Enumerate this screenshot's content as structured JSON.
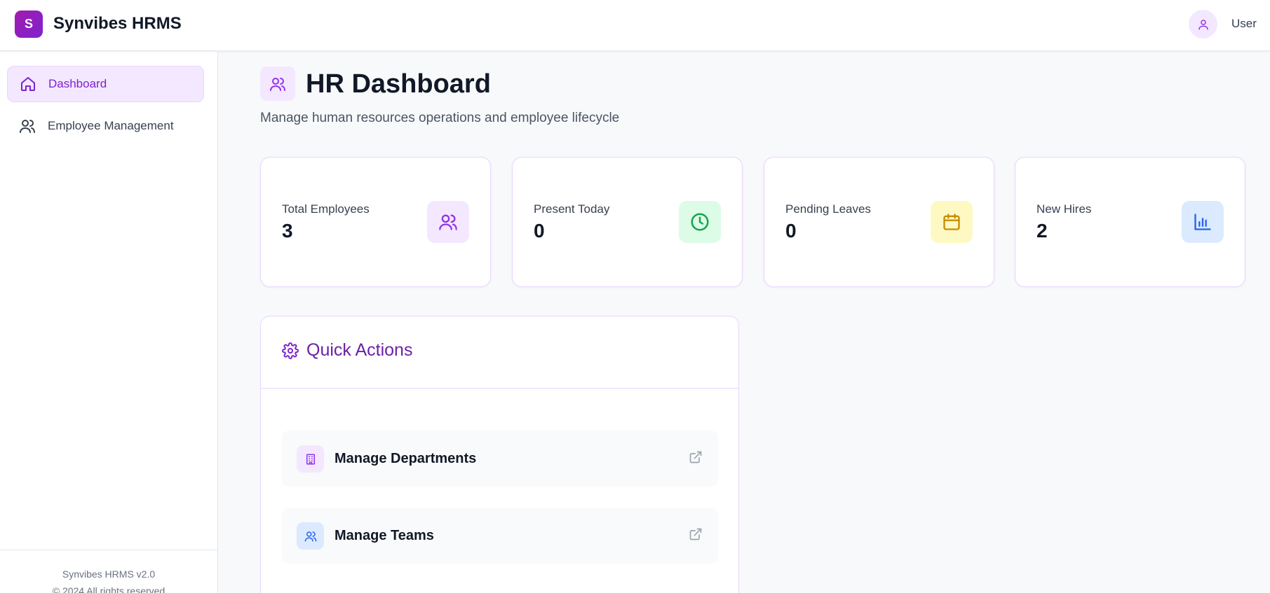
{
  "header": {
    "logo_letter": "S",
    "app_name": "Synvibes HRMS",
    "user_label": "User"
  },
  "sidebar": {
    "items": [
      {
        "label": "Dashboard",
        "icon": "home-icon",
        "active": true
      },
      {
        "label": "Employee Management",
        "icon": "users-icon",
        "active": false
      }
    ],
    "footer": {
      "version": "Synvibes HRMS v2.0",
      "copyright": "© 2024 All rights reserved"
    }
  },
  "main": {
    "title": "HR Dashboard",
    "subtitle": "Manage human resources operations and employee lifecycle",
    "stats": [
      {
        "label": "Total Employees",
        "value": "3",
        "icon": "users-icon",
        "color": "#9333ea",
        "bg": "#f3e8ff"
      },
      {
        "label": "Present Today",
        "value": "0",
        "icon": "clock-icon",
        "color": "#16a34a",
        "bg": "#dcfce7"
      },
      {
        "label": "Pending Leaves",
        "value": "0",
        "icon": "calendar-icon",
        "color": "#ca8a04",
        "bg": "#fef9c3"
      },
      {
        "label": "New Hires",
        "value": "2",
        "icon": "bar-chart-icon",
        "color": "#2563eb",
        "bg": "#dbeafe"
      }
    ],
    "quick_actions": {
      "title": "Quick Actions",
      "items": [
        {
          "label": "Manage Departments",
          "icon": "building-icon",
          "color": "#9333ea",
          "bg": "#f3e8ff"
        },
        {
          "label": "Manage Teams",
          "icon": "users-icon",
          "color": "#2563eb",
          "bg": "#dbeafe"
        }
      ]
    }
  },
  "colors": {
    "accent": "#7e22ce",
    "accent_light": "#f3e8ff",
    "card_border": "#e9d5ff"
  }
}
